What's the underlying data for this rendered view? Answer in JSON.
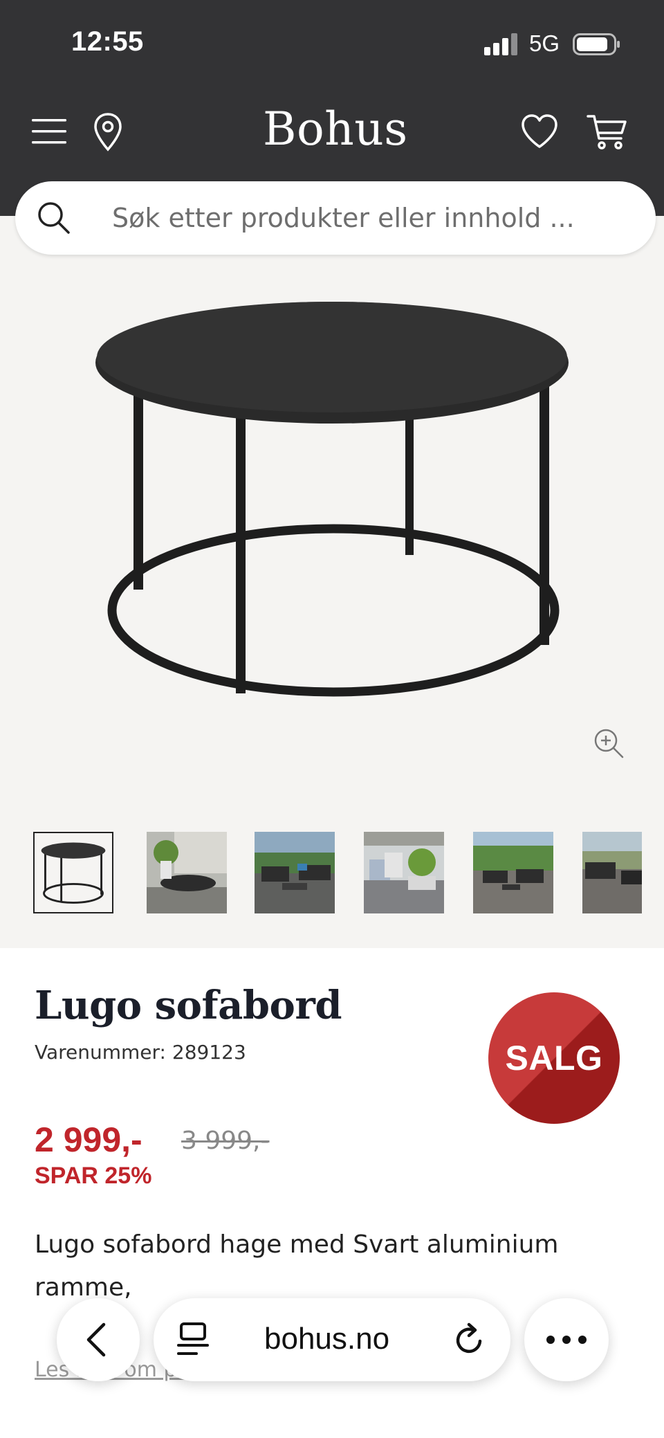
{
  "status_bar": {
    "time": "12:55",
    "network": "5G",
    "icons": [
      "signal-icon",
      "battery-icon"
    ]
  },
  "header": {
    "logo": "Bohus",
    "icons": [
      "menu-icon",
      "location-pin-icon",
      "heart-icon",
      "cart-icon"
    ],
    "background": "#333335"
  },
  "search": {
    "placeholder": "Søk etter produkter eller innhold ..."
  },
  "gallery": {
    "thumbnail_count": 6,
    "active_index": 0,
    "zoom_icon": "zoom-in-icon"
  },
  "product": {
    "title": "Lugo sofabord",
    "sku_label": "Varenummer: 289123",
    "badge": "SALG",
    "price": "2 999,-",
    "old_price": "3 999,-",
    "savings": "SPAR 25%",
    "description": "Lugo sofabord hage med Svart aluminium ramme,",
    "more_link": "Les mer om produktet"
  },
  "colors": {
    "accent_red": "#c0252b",
    "badge_light": "#c73a3a",
    "badge_dark": "#9c1c1c",
    "gallery_bg": "#f5f4f2"
  },
  "browser": {
    "url": "bohus.no",
    "icons": [
      "back-icon",
      "tabs-icon",
      "reload-icon",
      "more-icon"
    ]
  }
}
